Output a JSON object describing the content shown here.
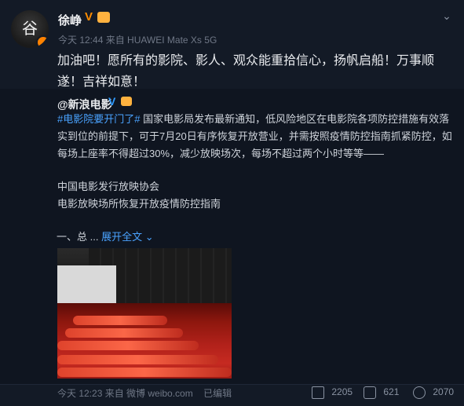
{
  "post": {
    "username": "徐峥",
    "meta": "今天 12:44 来自 HUAWEI Mate Xs 5G",
    "content": "加油吧！愿所有的影院、影人、观众能重拾信心，扬帆启船！万事顺遂！吉祥如意！"
  },
  "repost": {
    "username": "@新浪电影",
    "tag": "#电影院要开门了#",
    "text": " 国家电影局发布最新通知，低风险地区在电影院各项防控措施有效落实到位的前提下，可于7月20日有序恢复开放营业，并需按照疫情防控指南抓紧防控，如每场上座率不得超过30%，减少放映场次，每场不超过两个小时等等——",
    "org": "中国电影发行放映协会",
    "guide": "电影放映场所恢复开放疫情防控指南",
    "section_prefix": "一、总 ...",
    "expand_label": "展开全文 ⌄"
  },
  "footer": {
    "meta": "今天 12:23 来自 微博 weibo.com",
    "edited": "已编辑",
    "reposts": "2205",
    "comments": "621",
    "likes": "2070"
  },
  "icons": {
    "avatar_glyph": "谷"
  }
}
